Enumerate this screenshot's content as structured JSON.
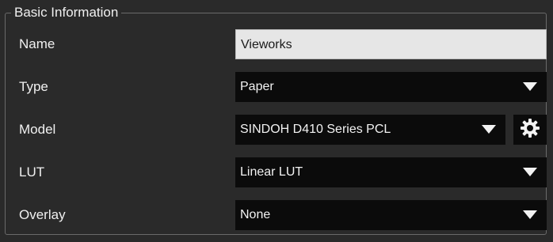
{
  "group": {
    "title": "Basic Information"
  },
  "rows": {
    "name": {
      "label": "Name",
      "value": "Vieworks"
    },
    "type": {
      "label": "Type",
      "value": "Paper",
      "icon": "chevron-down-icon"
    },
    "model": {
      "label": "Model",
      "value": "SINDOH D410 Series PCL",
      "icon": "chevron-down-icon",
      "settings_icon": "gear-icon"
    },
    "lut": {
      "label": "LUT",
      "value": "Linear LUT",
      "icon": "chevron-down-icon"
    },
    "overlay": {
      "label": "Overlay",
      "value": "None",
      "icon": "chevron-down-icon"
    }
  },
  "colors": {
    "background": "#2a2a2a",
    "combo_background": "#0b0b0b",
    "text_field_background": "#e6e6e6",
    "text": "#f0f0f0"
  }
}
